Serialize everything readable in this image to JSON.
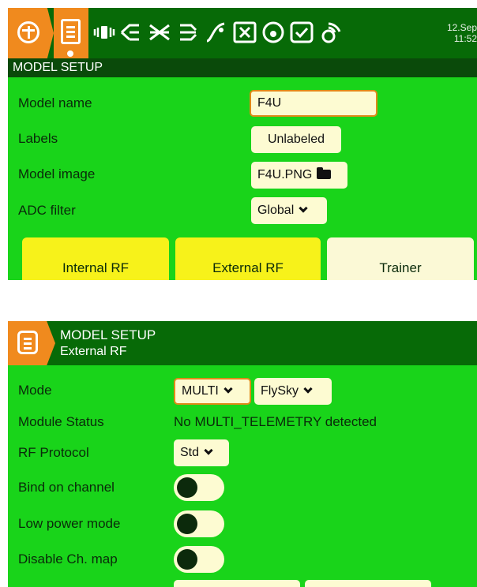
{
  "screen1": {
    "datetime": {
      "date": "12.Sep",
      "time": "11:52"
    },
    "icons": [
      "home-icon",
      "model-setup-icon",
      "vibration-icon",
      "flight-mode-icon",
      "mixer-icon",
      "outputs-icon",
      "curves-icon",
      "logical-switch-icon",
      "special-function-icon",
      "telemetry-icon"
    ],
    "title": "MODEL SETUP",
    "rows": {
      "model_name": {
        "label": "Model name",
        "value": "F4U"
      },
      "labels": {
        "label": "Labels",
        "value": "Unlabeled"
      },
      "model_image": {
        "label": "Model image",
        "value": "F4U.PNG"
      },
      "adc_filter": {
        "label": "ADC filter",
        "value": "Global"
      }
    },
    "rf_buttons": {
      "internal": "Internal RF",
      "external": "External RF",
      "trainer": "Trainer"
    }
  },
  "screen2": {
    "title": "MODEL SETUP",
    "subtitle": "External RF",
    "mode": {
      "label": "Mode",
      "value": "MULTI",
      "sub_value": "FlySky"
    },
    "module_status": {
      "label": "Module Status",
      "value": "No MULTI_TELEMETRY detected"
    },
    "rf_protocol": {
      "label": "RF Protocol",
      "value": "Std"
    },
    "bind_on_channel": {
      "label": "Bind on channel",
      "on": false
    },
    "low_power_mode": {
      "label": "Low power mode",
      "on": false
    },
    "disable_ch_map": {
      "label": "Disable Ch. map",
      "on": false
    }
  },
  "colors": {
    "background": "#19d41a",
    "header": "#076a07",
    "title_bar": "#0a4a0a",
    "accent": "#f08a1e",
    "field": "#fdfbd2",
    "rf_button": "#f7f21a"
  }
}
